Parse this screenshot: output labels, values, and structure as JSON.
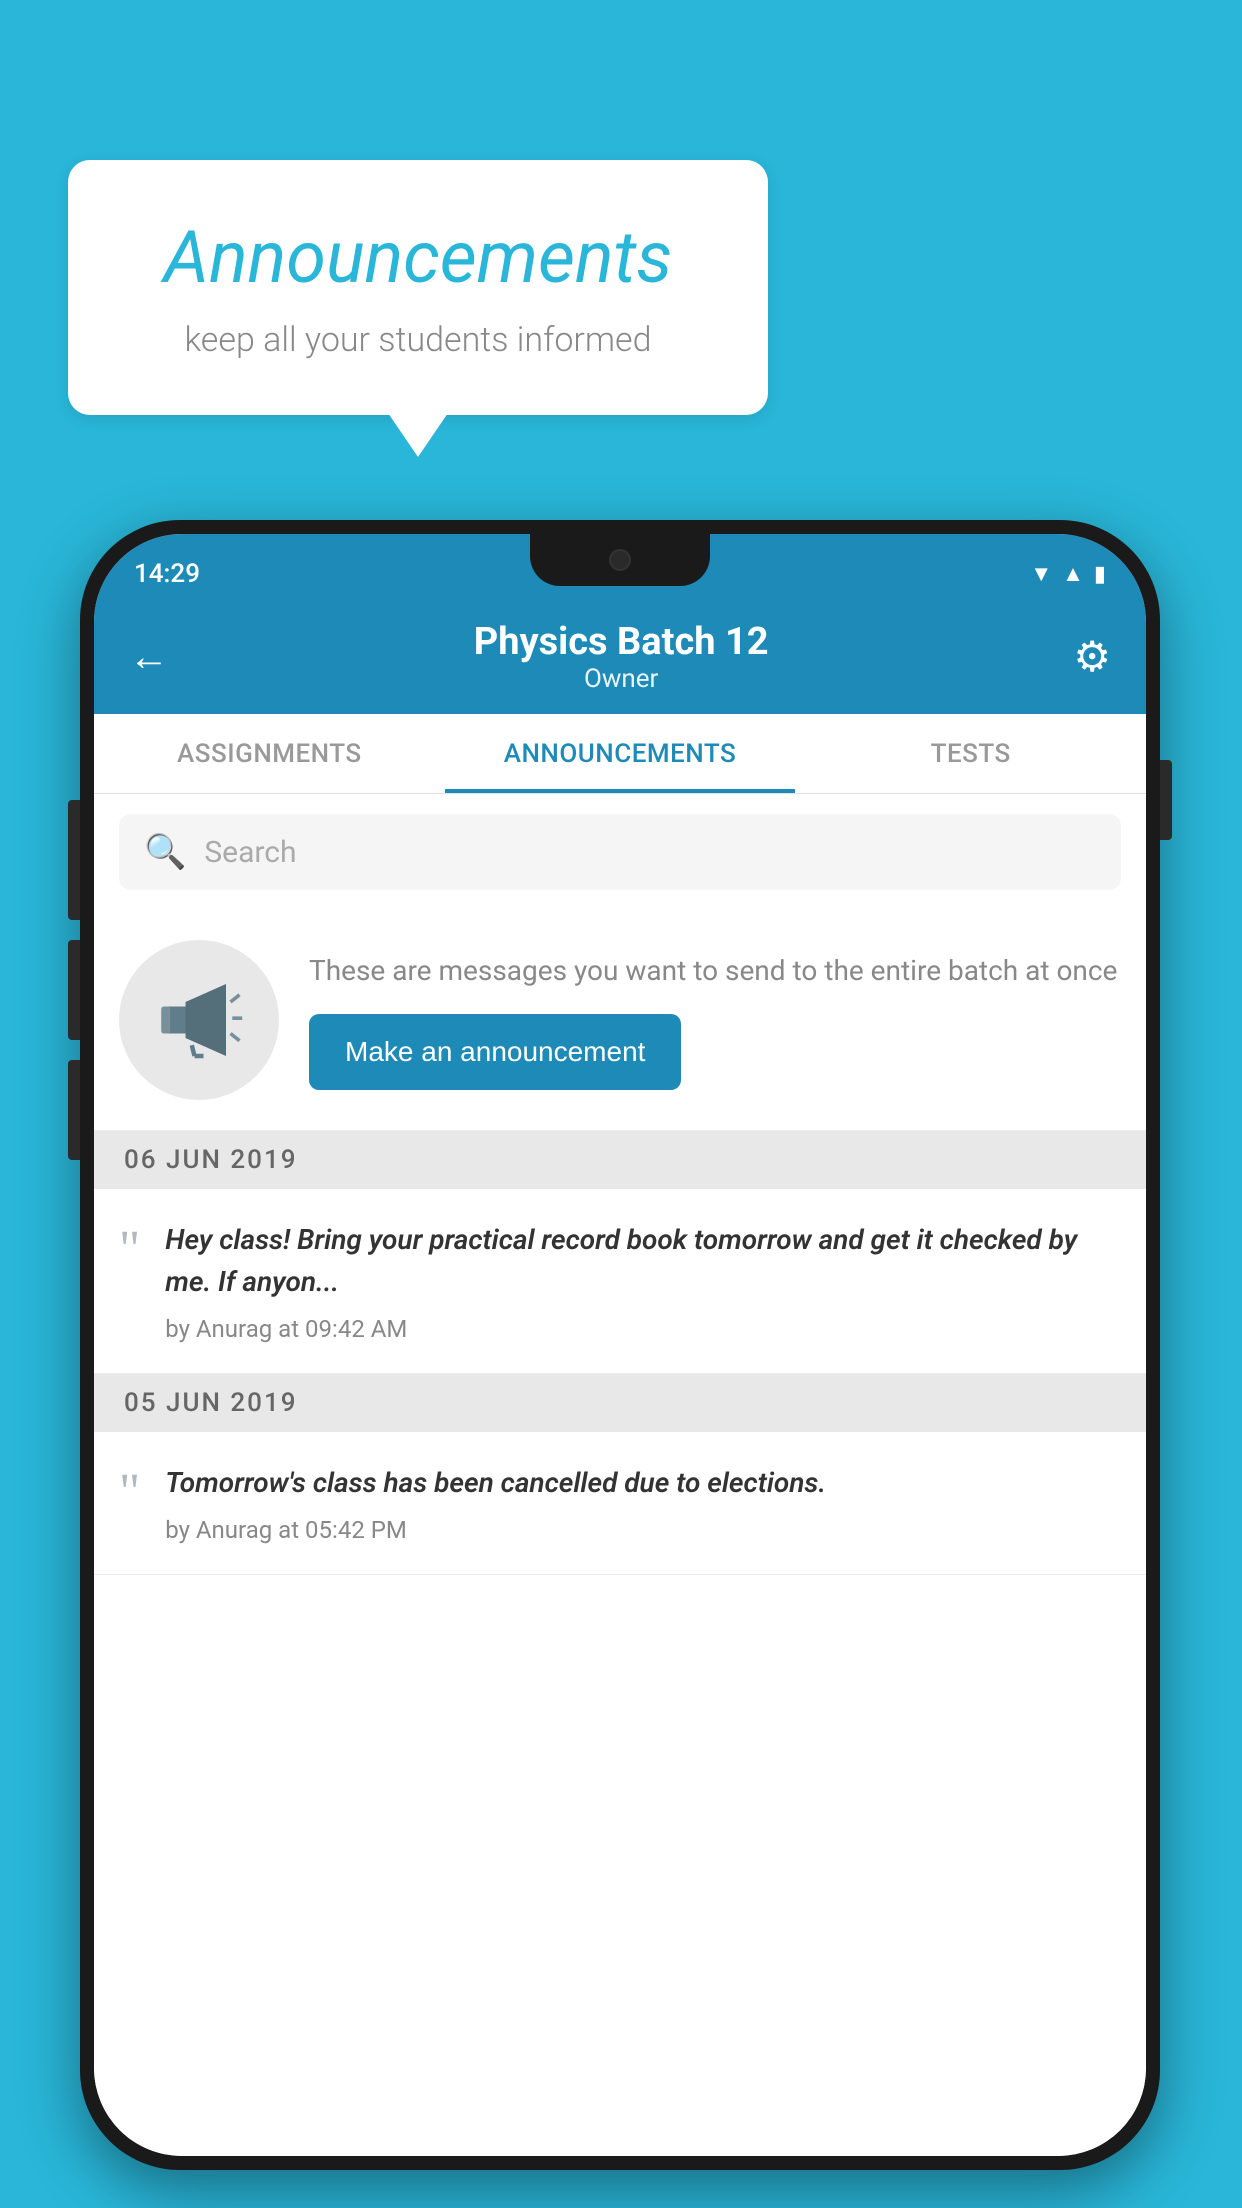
{
  "background_color": "#29b6d8",
  "speech_bubble": {
    "title": "Announcements",
    "subtitle": "keep all your students informed"
  },
  "phone": {
    "status_bar": {
      "time": "14:29",
      "icons": [
        "wifi",
        "signal",
        "battery"
      ]
    },
    "header": {
      "back_label": "←",
      "title": "Physics Batch 12",
      "subtitle": "Owner",
      "gear_label": "⚙"
    },
    "tabs": [
      {
        "label": "ASSIGNMENTS",
        "active": false
      },
      {
        "label": "ANNOUNCEMENTS",
        "active": true
      },
      {
        "label": "TESTS",
        "active": false
      }
    ],
    "search": {
      "placeholder": "Search"
    },
    "promo": {
      "description": "These are messages you want to send to the entire batch at once",
      "button_label": "Make an announcement"
    },
    "announcements": [
      {
        "date": "06  JUN  2019",
        "message": "Hey class! Bring your practical record book tomorrow and get it checked by me. If anyon...",
        "meta": "by Anurag at 09:42 AM"
      },
      {
        "date": "05  JUN  2019",
        "message": "Tomorrow's class has been cancelled due to elections.",
        "meta": "by Anurag at 05:42 PM"
      }
    ]
  }
}
